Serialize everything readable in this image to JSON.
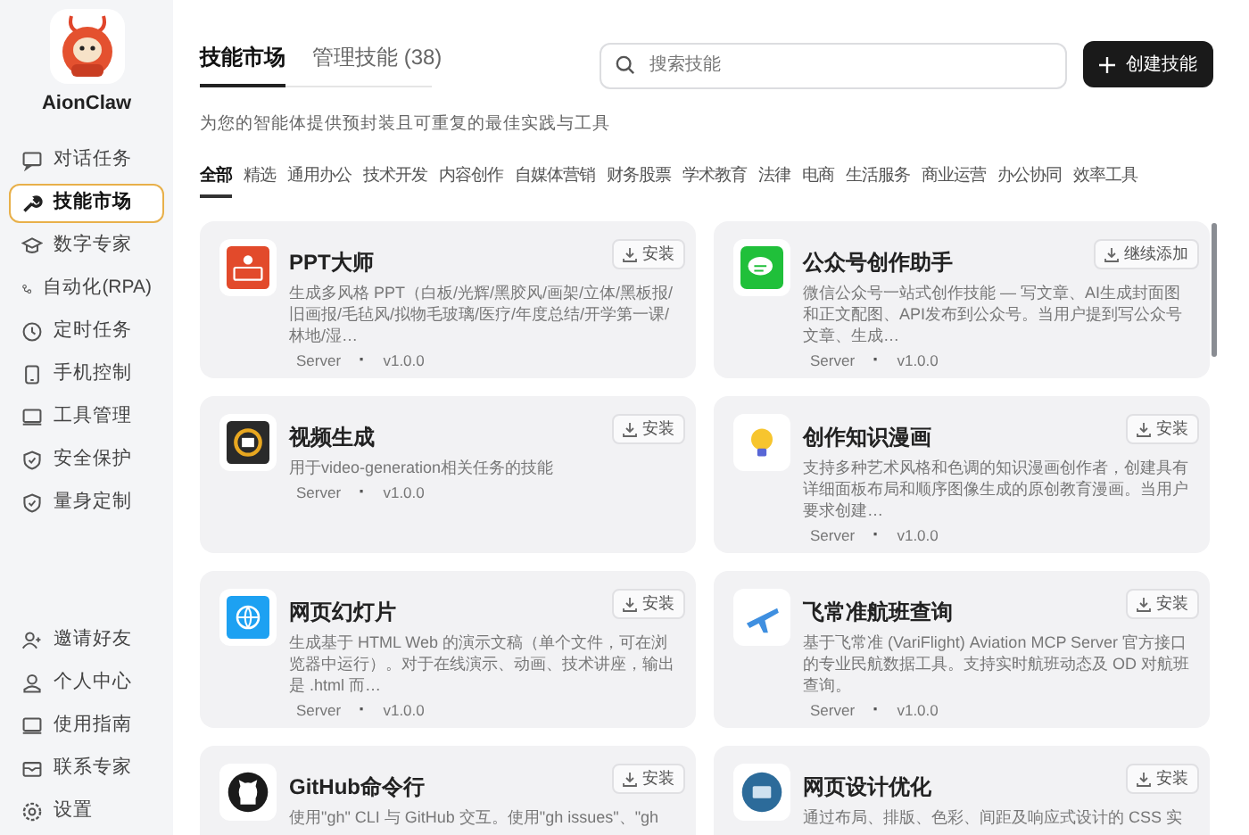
{
  "app": {
    "name": "AionClaw"
  },
  "sidebar": {
    "items": [
      {
        "label": "对话任务",
        "selected": false
      },
      {
        "label": "技能市场",
        "selected": true
      },
      {
        "label": "数字专家",
        "selected": false
      },
      {
        "label": "自动化(RPA)",
        "selected": false
      },
      {
        "label": "定时任务",
        "selected": false
      },
      {
        "label": "手机控制",
        "selected": false
      },
      {
        "label": "工具管理",
        "selected": false
      },
      {
        "label": "安全保护",
        "selected": false
      },
      {
        "label": "量身定制",
        "selected": false
      }
    ],
    "bottom_items": [
      {
        "label": "邀请好友"
      },
      {
        "label": "个人中心"
      },
      {
        "label": "使用指南"
      },
      {
        "label": "联系专家"
      },
      {
        "label": "设置"
      }
    ]
  },
  "tabs": [
    {
      "label": "技能市场",
      "selected": true
    },
    {
      "label": "管理技能 (38)",
      "selected": false
    }
  ],
  "search": {
    "placeholder": "搜索技能"
  },
  "create_button": {
    "label": "创建技能"
  },
  "subtitle": "为您的智能体提供预封装且可重复的最佳实践与工具",
  "categories": [
    {
      "label": "全部",
      "selected": true
    },
    {
      "label": "精选",
      "selected": false
    },
    {
      "label": "通用办公",
      "selected": false
    },
    {
      "label": "技术开发",
      "selected": false
    },
    {
      "label": "内容创作",
      "selected": false
    },
    {
      "label": "自媒体营销",
      "selected": false
    },
    {
      "label": "财务股票",
      "selected": false
    },
    {
      "label": "学术教育",
      "selected": false
    },
    {
      "label": "法律",
      "selected": false
    },
    {
      "label": "电商",
      "selected": false
    },
    {
      "label": "生活服务",
      "selected": false
    },
    {
      "label": "商业运营",
      "selected": false
    },
    {
      "label": "办公协同",
      "selected": false
    },
    {
      "label": "效率工具",
      "selected": false
    }
  ],
  "skills": [
    {
      "title": "PPT大师",
      "description": "生成多风格 PPT（白板/光辉/黑胶风/画架/立体/黑板报/旧画报/毛毡风/拟物毛玻璃/医疗/年度总结/开学第一课/林地/湿…",
      "type": "Server",
      "separator": "·",
      "version": "v1.0.0",
      "action": "安装"
    },
    {
      "title": "公众号创作助手",
      "description": "微信公众号一站式创作技能 — 写文章、AI生成封面图和正文配图、API发布到公众号。当用户提到写公众号文章、生成…",
      "type": "Server",
      "separator": "·",
      "version": "v1.0.0",
      "action": "继续添加"
    },
    {
      "title": "视频生成",
      "description": "用于video-generation相关任务的技能",
      "type": "Server",
      "separator": "·",
      "version": "v1.0.0",
      "action": "安装"
    },
    {
      "title": "创作知识漫画",
      "description": "支持多种艺术风格和色调的知识漫画创作者，创建具有详细面板布局和顺序图像生成的原创教育漫画。当用户要求创建…",
      "type": "Server",
      "separator": "·",
      "version": "v1.0.0",
      "action": "安装"
    },
    {
      "title": "网页幻灯片",
      "description": "生成基于 HTML Web 的演示文稿（单个文件，可在浏览器中运行）。对于在线演示、动画、技术讲座，输出是 .html 而…",
      "type": "Server",
      "separator": "·",
      "version": "v1.0.0",
      "action": "安装"
    },
    {
      "title": "飞常准航班查询",
      "description": "基于飞常准 (VariFlight) Aviation MCP Server 官方接口的专业民航数据工具。支持实时航班动态及 OD 对航班查询。",
      "type": "Server",
      "separator": "·",
      "version": "v1.0.0",
      "action": "安装"
    },
    {
      "title": "GitHub命令行",
      "description": "使用\"gh\" CLI 与 GitHub 交互。使用\"gh issues\"、\"gh",
      "action": "安装"
    },
    {
      "title": "网页设计优化",
      "description": "通过布局、排版、色彩、间距及响应式设计的 CSS 实",
      "action": "安装"
    }
  ]
}
